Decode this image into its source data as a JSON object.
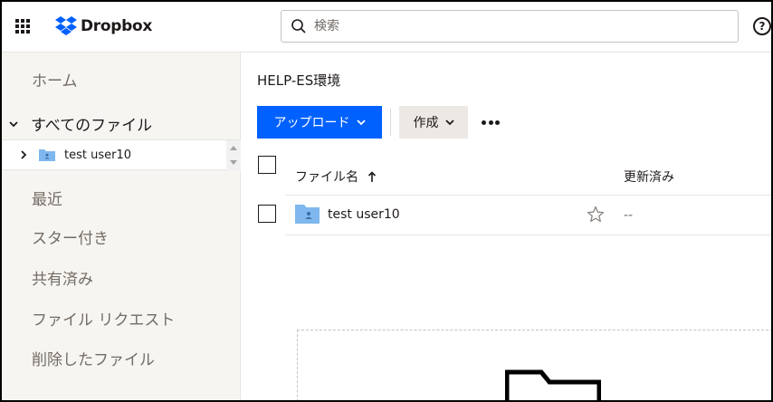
{
  "app": {
    "brand": "Dropbox",
    "accent": "#0061fe",
    "folder_color": "#7fb8ee"
  },
  "topbar": {
    "apps_icon": "grid-icon",
    "search_placeholder": "検索",
    "help_label": "?"
  },
  "sidebar": {
    "home": "ホーム",
    "all_files": "すべてのファイル",
    "tree_item": "test user10",
    "recent": "最近",
    "starred": "スター付き",
    "shared": "共有済み",
    "file_requests": "ファイル リクエスト",
    "deleted": "削除したファイル"
  },
  "main": {
    "breadcrumb": "HELP-ES環境",
    "upload_label": "アップロード",
    "create_label": "作成",
    "columns": {
      "name": "ファイル名",
      "modified": "更新済み"
    },
    "rows": [
      {
        "name": "test user10",
        "modified": "--"
      }
    ]
  }
}
